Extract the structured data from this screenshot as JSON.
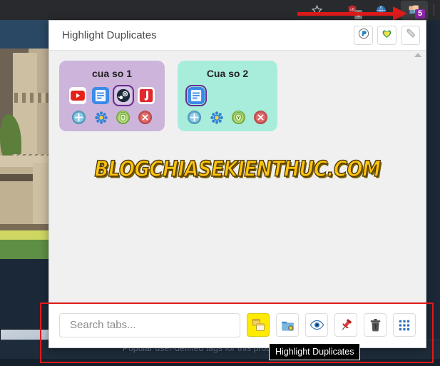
{
  "browser": {
    "toolbar": {
      "star_icon": "star-icon",
      "shield_icon": "shield-icon",
      "shield_badge": "1",
      "globe_icon": "globe-icon",
      "extension_icon": "tab-manager-extension-icon",
      "extension_badge": "5"
    },
    "annotation": {
      "arrow_color": "#e01b1b"
    }
  },
  "background": {
    "tag_section_label": "Popular user-defined tags for this produ"
  },
  "popup": {
    "title": "Highlight Duplicates",
    "header_buttons": [
      {
        "name": "paypal-donate-button",
        "icon": "paypal-icon",
        "color": "#139ad6"
      },
      {
        "name": "favorite-button",
        "icon": "heart-icon",
        "color": "#7ac943"
      },
      {
        "name": "settings-button",
        "icon": "wrench-icon",
        "color": "#9a9a9a"
      }
    ],
    "windows": [
      {
        "name": "cua so 1",
        "bg_color": "#cdb4db",
        "tabs": [
          {
            "name": "youtube-tab",
            "icon": "youtube-icon",
            "label": "YouTube"
          },
          {
            "name": "document-tab",
            "icon": "document-icon",
            "label": "Document"
          },
          {
            "name": "steam-tab",
            "icon": "steam-icon",
            "label": "Steam",
            "selected": true
          },
          {
            "name": "javhd-tab",
            "icon": "letter-j-icon",
            "label": "J"
          }
        ],
        "actions": [
          {
            "name": "add-tab-button",
            "icon": "plus-circle-icon"
          },
          {
            "name": "window-settings-button",
            "icon": "gear-icon"
          },
          {
            "name": "protect-window-button",
            "icon": "shield-y-icon"
          },
          {
            "name": "close-window-button",
            "icon": "close-circle-icon"
          }
        ]
      },
      {
        "name": "Cua so 2",
        "bg_color": "#a8eddc",
        "tabs": [
          {
            "name": "document-tab",
            "icon": "document-icon",
            "label": "Document",
            "selected": true
          }
        ],
        "actions": [
          {
            "name": "add-tab-button",
            "icon": "plus-circle-icon"
          },
          {
            "name": "window-settings-button",
            "icon": "gear-icon"
          },
          {
            "name": "protect-window-button",
            "icon": "shield-y-icon"
          },
          {
            "name": "close-window-button",
            "icon": "close-circle-icon"
          }
        ]
      }
    ],
    "watermark": "BLOGCHIASEKIENTHUC.COM",
    "footer": {
      "search_placeholder": "Search tabs...",
      "search_value": "",
      "buttons": [
        {
          "name": "highlight-duplicates-button",
          "icon": "duplicate-windows-icon",
          "active": true
        },
        {
          "name": "save-session-button",
          "icon": "folder-icon",
          "active": false
        },
        {
          "name": "preview-button",
          "icon": "eye-icon",
          "active": false
        },
        {
          "name": "pin-button",
          "icon": "pin-icon",
          "active": false
        },
        {
          "name": "delete-button",
          "icon": "trash-icon",
          "active": false
        },
        {
          "name": "grid-view-button",
          "icon": "grid-icon",
          "active": false
        }
      ]
    },
    "tooltip": "Highlight Duplicates"
  }
}
